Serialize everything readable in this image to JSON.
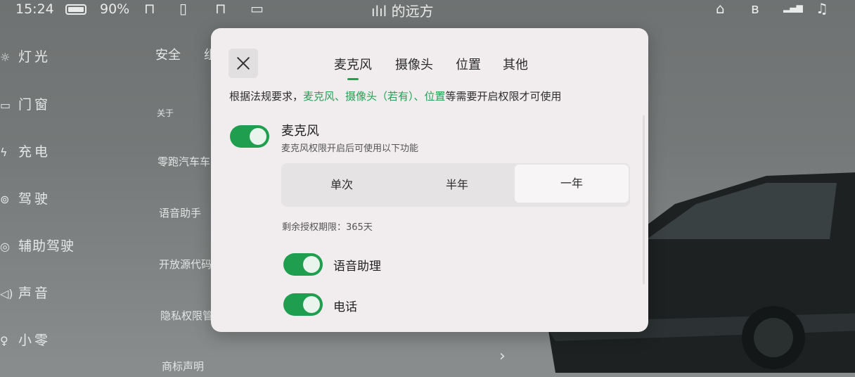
{
  "status_bar": {
    "time": "15:24",
    "battery": "90%",
    "media_title": "ılıl 的远方",
    "icons": [
      "battery-icon",
      "lock-open-icon",
      "phone-vibrate-icon",
      "lock-rotate-icon",
      "dashcam-icon",
      "trash-icon",
      "bluetooth-icon",
      "signal-4g-icon",
      "bell-icon"
    ]
  },
  "bg_nav": {
    "items": [
      {
        "icon": "☼",
        "label": "灯光"
      },
      {
        "icon": "▭",
        "label": "门窗"
      },
      {
        "icon": "ϟ",
        "label": "充电"
      },
      {
        "icon": "⊚",
        "label": "驾驶"
      },
      {
        "icon": "◎",
        "label": "辅助驾驶"
      },
      {
        "icon": "◁)",
        "label": "声音"
      },
      {
        "icon": "♀",
        "label": "小零"
      }
    ]
  },
  "bg_main": {
    "tab_safety": "安全",
    "tab_partial": "组",
    "section_about": "关于",
    "rows": [
      "零跑汽车车",
      "语音助手",
      "开放源代码",
      "隐私权限管",
      "商标声明"
    ]
  },
  "modal": {
    "tabs": [
      {
        "label": "麦克风",
        "active": true
      },
      {
        "label": "摄像头",
        "active": false
      },
      {
        "label": "位置",
        "active": false
      },
      {
        "label": "其他",
        "active": false
      }
    ],
    "notice": {
      "prefix": "根据法规要求，",
      "highlight": "麦克风、摄像头（若有）、位置",
      "suffix": "等需要开启权限才可使用"
    },
    "permission": {
      "title": "麦克风",
      "description": "麦克风权限开启后可使用以下功能",
      "enabled": true
    },
    "duration_options": [
      {
        "label": "单次",
        "selected": false
      },
      {
        "label": "半年",
        "selected": false
      },
      {
        "label": "一年",
        "selected": true
      }
    ],
    "remaining": "剩余授权期限：365天",
    "functions": [
      {
        "label": "语音助理",
        "enabled": true
      },
      {
        "label": "电话",
        "enabled": true
      }
    ]
  },
  "colors": {
    "accent_green": "#1e9e4e",
    "modal_bg": "#f1edee"
  }
}
